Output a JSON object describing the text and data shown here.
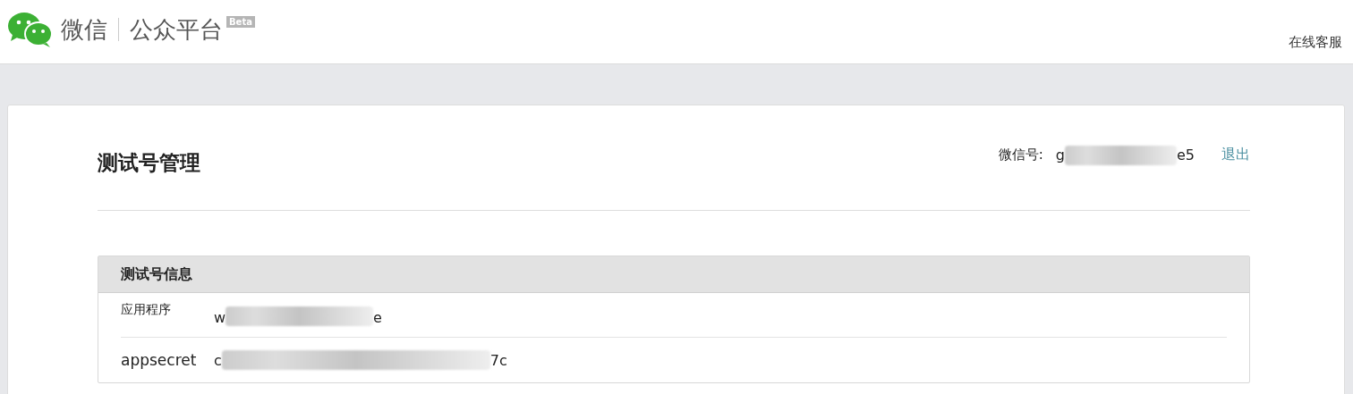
{
  "header": {
    "brand": "微信",
    "product": "公众平台",
    "badge": "Beta",
    "service_link": "在线客服"
  },
  "page": {
    "title": "测试号管理",
    "account_label": "微信号:",
    "account_start": "g",
    "account_end": "e5",
    "logout": "退出"
  },
  "panel": {
    "title": "测试号信息",
    "rows": [
      {
        "label": "应用程序",
        "value_start": "w",
        "value_end": "e",
        "redacted": true
      },
      {
        "label": "appsecret",
        "value_start": "c",
        "value_end": "7c",
        "redacted": true
      }
    ]
  }
}
